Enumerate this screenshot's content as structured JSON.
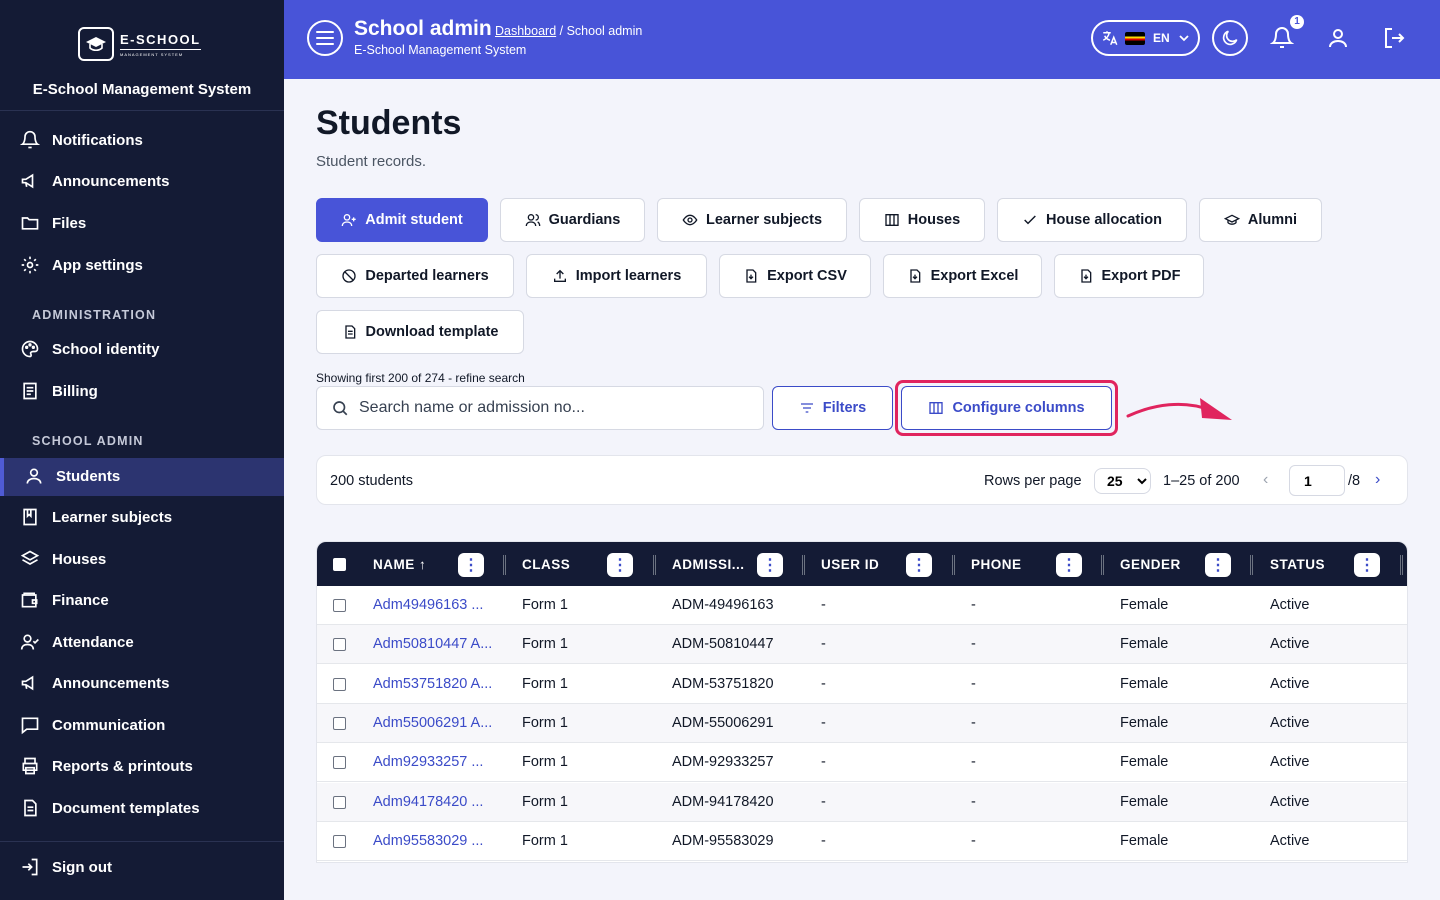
{
  "sidebar": {
    "logo_name": "E-SCHOOL",
    "logo_sub": "MANAGEMENT SYSTEM",
    "system_name": "E-School Management System",
    "items_top": [
      "Notifications",
      "Announcements",
      "Files",
      "App settings"
    ],
    "section_admin": "ADMINISTRATION",
    "items_admin": [
      "School identity",
      "Billing"
    ],
    "section_school": "SCHOOL ADMIN",
    "items_school": [
      "Students",
      "Learner subjects",
      "Houses",
      "Finance",
      "Attendance",
      "Announcements",
      "Communication",
      "Reports & printouts",
      "Document templates"
    ],
    "sign_out": "Sign out"
  },
  "header": {
    "title": "School admin",
    "crumb_link": "Dashboard",
    "crumb_rest": " / School admin",
    "subtitle": "E-School Management System",
    "language": "EN",
    "notification_count": "1",
    "accent_color": "#4854d8"
  },
  "page": {
    "title": "Students",
    "subtitle": "Student records."
  },
  "actions": {
    "admit": "Admit student",
    "guardians": "Guardians",
    "learner_subjects": "Learner subjects",
    "houses": "Houses",
    "house_allocation": "House allocation",
    "alumni": "Alumni",
    "departed": "Departed learners",
    "import": "Import learners",
    "export_csv": "Export CSV",
    "export_excel": "Export Excel",
    "export_pdf": "Export PDF",
    "download_template": "Download template"
  },
  "search": {
    "showing": "Showing first 200 of 274 - refine search",
    "placeholder": "Search name or admission no...",
    "filters": "Filters",
    "configure": "Configure columns"
  },
  "pagination": {
    "count": "200 students",
    "rows_label": "Rows per page",
    "rows_value": "25",
    "range": "1–25 of 200",
    "page": "1",
    "of": "/8"
  },
  "table": {
    "columns": [
      "NAME ↑",
      "CLASS",
      "ADMISSI...",
      "USER ID",
      "PHONE",
      "GENDER",
      "STATUS"
    ],
    "rows": [
      [
        "Adm49496163 ...",
        "Form 1",
        "ADM-49496163",
        "-",
        "-",
        "Female",
        "Active"
      ],
      [
        "Adm50810447 A...",
        "Form 1",
        "ADM-50810447",
        "-",
        "-",
        "Female",
        "Active"
      ],
      [
        "Adm53751820 A...",
        "Form 1",
        "ADM-53751820",
        "-",
        "-",
        "Female",
        "Active"
      ],
      [
        "Adm55006291 A...",
        "Form 1",
        "ADM-55006291",
        "-",
        "-",
        "Female",
        "Active"
      ],
      [
        "Adm92933257 ...",
        "Form 1",
        "ADM-92933257",
        "-",
        "-",
        "Female",
        "Active"
      ],
      [
        "Adm94178420 ...",
        "Form 1",
        "ADM-94178420",
        "-",
        "-",
        "Female",
        "Active"
      ],
      [
        "Adm95583029 ...",
        "Form 1",
        "ADM-95583029",
        "-",
        "-",
        "Female",
        "Active"
      ]
    ]
  }
}
